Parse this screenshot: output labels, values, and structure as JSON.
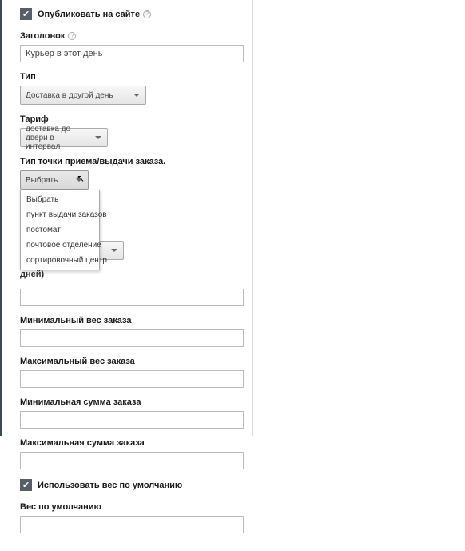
{
  "publish": {
    "label": "Опубликовать на сайте"
  },
  "heading": {
    "label": "Заголовок",
    "value": "Курьер в этот день"
  },
  "type": {
    "label": "Тип",
    "value": "Доставка в другой день"
  },
  "tariff": {
    "label": "Тариф",
    "value": "доставка до двери в интервал"
  },
  "pickup_type": {
    "label": "Тип точки приема/выдачи заказа.",
    "value": "Выбрать",
    "options": [
      "Выбрать",
      "пункт выдачи заказов",
      "постомат",
      "почтовое отделение",
      "сортировочный центр"
    ]
  },
  "partial_row": {
    "select_value": "",
    "suffix": "дней)"
  },
  "min_weight": {
    "label": "Минимальный вес заказа",
    "value": ""
  },
  "max_weight": {
    "label": "Максимальный вес заказа",
    "value": ""
  },
  "min_sum": {
    "label": "Минимальная сумма заказа",
    "value": ""
  },
  "max_sum": {
    "label": "Максимальная сумма заказа",
    "value": ""
  },
  "use_default_weight": {
    "label": "Использовать вес по умолчанию"
  },
  "default_weight": {
    "label": "Вес по умолчанию",
    "value": ""
  }
}
